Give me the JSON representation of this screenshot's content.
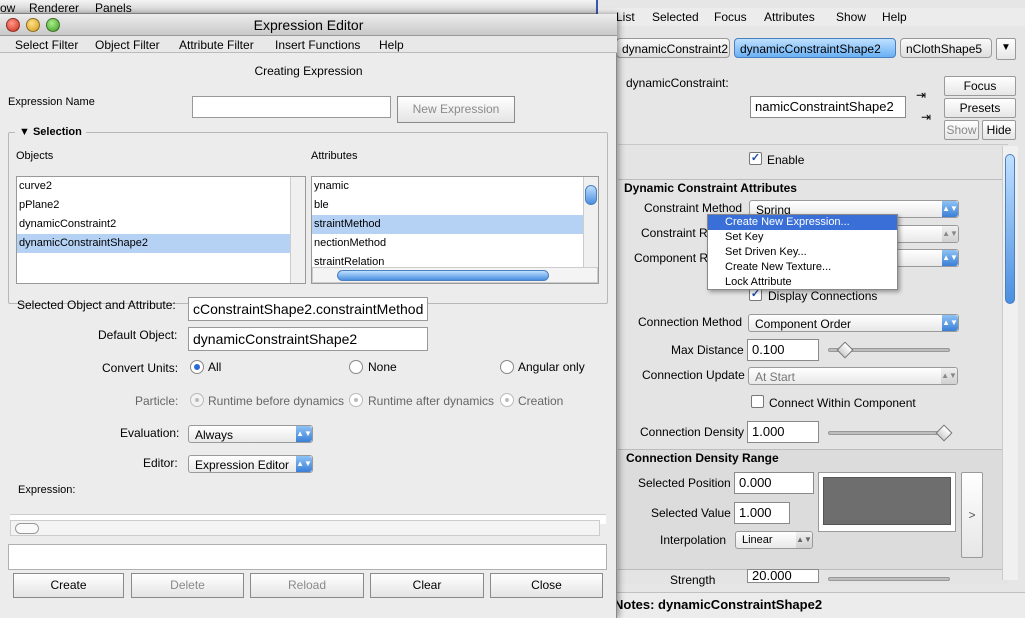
{
  "bg_menubar": {
    "items": [
      "ow",
      "Renderer",
      "Panels"
    ]
  },
  "attr_editor": {
    "menu": [
      "List",
      "Selected",
      "Focus",
      "Attributes",
      "Show",
      "Help"
    ],
    "tabs": [
      "dynamicConstraint2",
      "dynamicConstraintShape2",
      "nClothShape5"
    ],
    "node_label": "dynamicConstraint:",
    "node_value": "namicConstraintShape2",
    "focus_label": "Focus",
    "presets_label": "Presets",
    "show_label": "Show",
    "hide_label": "Hide",
    "enable_label": "Enable",
    "section_title": "Dynamic Constraint Attributes",
    "constraint_method_label": "Constraint Method",
    "constraint_method_value": "Spring",
    "constraint_r_label": "Constraint R",
    "component_r_label": "Component R",
    "display_connections_label": "Display Connections",
    "connection_method_label": "Connection Method",
    "connection_method_value": "Component Order",
    "max_distance_label": "Max Distance",
    "max_distance_value": "0.100",
    "max_distance_level": 0.1,
    "connection_update_label": "Connection Update",
    "connection_update_value": "At Start",
    "connect_within_label": "Connect Within Component",
    "connection_density_label": "Connection Density",
    "connection_density_value": "1.000",
    "connection_density_level": 1.0,
    "density_range_title": "Connection Density Range",
    "selected_position_label": "Selected Position",
    "selected_position_value": "0.000",
    "selected_value_label": "Selected Value",
    "selected_value_value": "1.000",
    "interpolation_label": "Interpolation",
    "interpolation_value": "Linear",
    "ramp_arrow": ">",
    "strength_label": "Strength",
    "strength_value": "20.000",
    "notes_label": "Notes:  dynamicConstraintShape2"
  },
  "context_menu": {
    "items": [
      "Create New Expression...",
      "Set Key",
      "Set Driven Key...",
      "Create New Texture...",
      "Lock Attribute"
    ]
  },
  "expr_editor": {
    "title": "Expression Editor",
    "menu": [
      "Select Filter",
      "Object Filter",
      "Attribute Filter",
      "Insert Functions",
      "Help"
    ],
    "status": "Creating Expression",
    "expression_name_label": "Expression Name",
    "expression_name_value": "",
    "new_expression_label": "New Expression",
    "selection_label": "Selection",
    "objects_label": "Objects",
    "attributes_label": "Attributes",
    "objects": [
      "curve2",
      "pPlane2",
      "dynamicConstraint2",
      "dynamicConstraintShape2"
    ],
    "attributes": [
      "ynamic",
      "ble",
      "straintMethod",
      "nectionMethod",
      "straintRelation"
    ],
    "selected_obj_attr_label": "Selected Object and Attribute:",
    "selected_obj_attr_value": "cConstraintShape2.constraintMethod",
    "default_object_label": "Default Object:",
    "default_object_value": "dynamicConstraintShape2",
    "convert_units_label": "Convert Units:",
    "convert_units_options": [
      "All",
      "None",
      "Angular only"
    ],
    "particle_label": "Particle:",
    "particle_options": [
      "Runtime before dynamics",
      "Runtime after dynamics",
      "Creation"
    ],
    "evaluation_label": "Evaluation:",
    "evaluation_value": "Always",
    "editor_label": "Editor:",
    "editor_value": "Expression Editor",
    "expression_label": "Expression:",
    "buttons": {
      "create": "Create",
      "delete": "Delete",
      "reload": "Reload",
      "clear": "Clear",
      "close": "Close"
    }
  },
  "colors": {
    "accent": "#3a6fd8",
    "selection": "#b5d2f5",
    "tab_active": "#6ab0f5"
  }
}
